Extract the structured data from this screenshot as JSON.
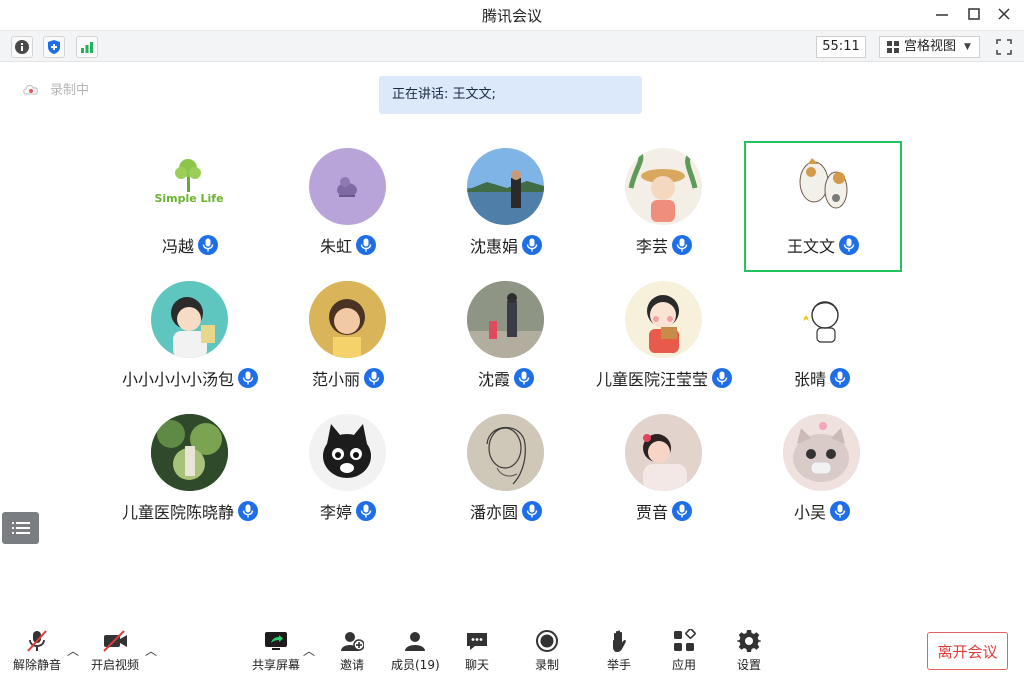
{
  "window": {
    "title": "腾讯会议"
  },
  "toolbar": {
    "timer": "55:11",
    "view_label": "宫格视图"
  },
  "recording": {
    "label": "录制中"
  },
  "speaking": {
    "label": "正在讲话: 王文文;"
  },
  "participants": [
    {
      "name": "冯越"
    },
    {
      "name": "朱虹"
    },
    {
      "name": "沈惠娟"
    },
    {
      "name": "李芸"
    },
    {
      "name": "王文文",
      "active": true
    },
    {
      "name": "小小小小小汤包"
    },
    {
      "name": "范小丽"
    },
    {
      "name": "沈霞"
    },
    {
      "name": "儿童医院汪莹莹"
    },
    {
      "name": "张晴"
    },
    {
      "name": "儿童医院陈晓静"
    },
    {
      "name": "李婷"
    },
    {
      "name": "潘亦圆"
    },
    {
      "name": "贾音"
    },
    {
      "name": "小吴"
    }
  ],
  "avatar_text": {
    "simple_life": "Simple Life"
  },
  "bottom": {
    "mute": "解除静音",
    "video": "开启视频",
    "share": "共享屏幕",
    "invite": "邀请",
    "members": "成员(19)",
    "chat": "聊天",
    "record": "录制",
    "raise_hand": "举手",
    "apps": "应用",
    "settings": "设置",
    "leave": "离开会议"
  },
  "colors": {
    "accent": "#1e6ee8",
    "active_border": "#23c35f",
    "leave": "#e03b3b",
    "speaking_bg": "#dbe9fb"
  }
}
